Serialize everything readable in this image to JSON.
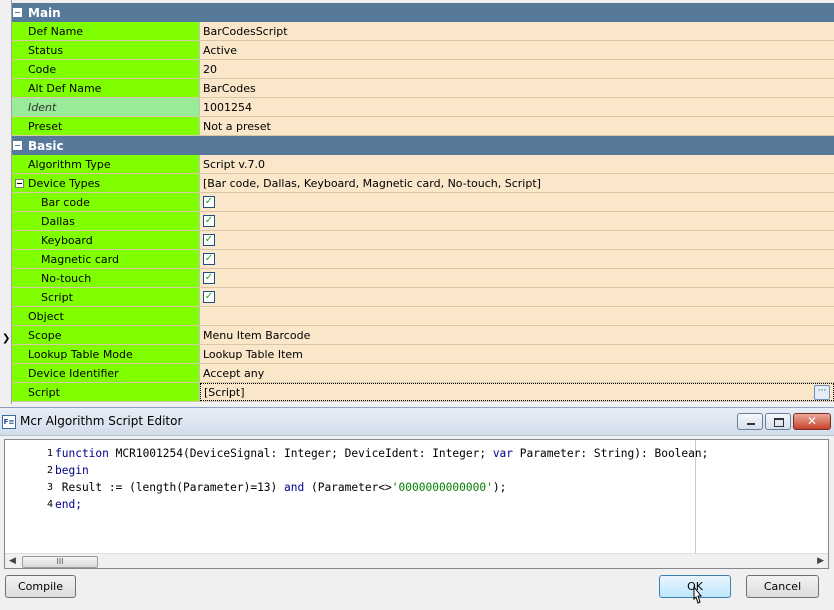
{
  "grid": {
    "sections": [
      {
        "label": "Main",
        "rows": [
          {
            "name": "Def Name",
            "value": "BarCodesScript"
          },
          {
            "name": "Status",
            "value": "Active"
          },
          {
            "name": "Code",
            "value": "20"
          },
          {
            "name": "Alt Def Name",
            "value": "BarCodes"
          },
          {
            "name": "Ident",
            "value": "1001254",
            "readonly": true
          },
          {
            "name": "Preset",
            "value": "Not a preset"
          }
        ]
      },
      {
        "label": "Basic",
        "rows": [
          {
            "name": "Algorithm Type",
            "value": "Script v.7.0"
          },
          {
            "name": "Device Types",
            "value": "[Bar code, Dallas, Keyboard, Magnetic card, No-touch, Script]",
            "expanded": true
          },
          {
            "name": "Bar code",
            "checked": true,
            "sub": true
          },
          {
            "name": "Dallas",
            "checked": true,
            "sub": true
          },
          {
            "name": "Keyboard",
            "checked": true,
            "sub": true
          },
          {
            "name": "Magnetic card",
            "checked": true,
            "sub": true
          },
          {
            "name": "No-touch",
            "checked": true,
            "sub": true
          },
          {
            "name": "Script",
            "checked": true,
            "sub": true
          },
          {
            "name": "Object",
            "value": ""
          },
          {
            "name": "Scope",
            "value": "Menu Item Barcode"
          },
          {
            "name": "Lookup Table Mode",
            "value": "Lookup Table Item"
          },
          {
            "name": "Device Identifier",
            "value": "Accept any"
          },
          {
            "name": "Script",
            "value": "[Script]",
            "selected": true
          }
        ]
      }
    ],
    "checkmark": "✓",
    "ellipsis": "···"
  },
  "editor": {
    "app_icon_text": "F≡",
    "title": "Mcr Algorithm Script Editor",
    "close_glyph": "✕",
    "line_numbers": [
      "1",
      "2",
      "3",
      "4"
    ],
    "code": [
      [
        {
          "t": "function",
          "c": "kw"
        },
        {
          "t": " MCR1001254(DeviceSignal: Integer; DeviceIdent: Integer; "
        },
        {
          "t": "var",
          "c": "kw"
        },
        {
          "t": " Parameter: String): Boolean;"
        }
      ],
      [
        {
          "t": "begin",
          "c": "kw"
        }
      ],
      [
        {
          "t": " Result := (length(Parameter)=13) "
        },
        {
          "t": "and",
          "c": "kw"
        },
        {
          "t": " (Parameter<>"
        },
        {
          "t": "'0000000000000'",
          "c": "str"
        },
        {
          "t": ");"
        }
      ],
      [
        {
          "t": "end;",
          "c": "kw"
        }
      ]
    ],
    "scroll_thumb_text": "III",
    "compile_label": "Compile",
    "ok_label": "OK",
    "cancel_label": "Cancel"
  }
}
